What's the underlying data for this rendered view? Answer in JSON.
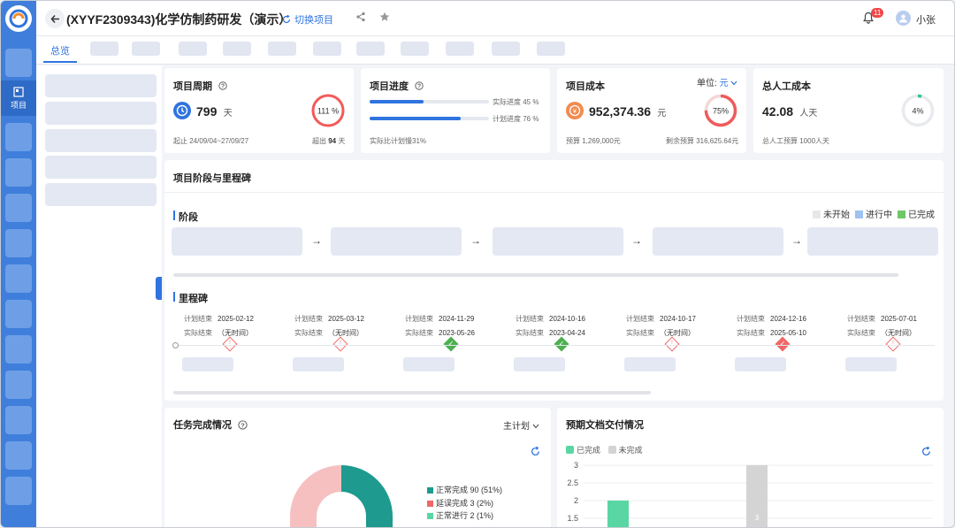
{
  "header": {
    "title": "(XYYF2309343)化学仿制药研发（演示）",
    "switch_label": "切换项目",
    "notification_count": "11",
    "user_name": "小张"
  },
  "rail": {
    "active_label": "项目"
  },
  "tabs": {
    "active": "总览"
  },
  "period": {
    "title": "项目周期",
    "days": "799",
    "unit": "天",
    "percent": "111 %",
    "range": "起止 24/09/04~27/09/27",
    "over_label": "超出",
    "over_days": "94",
    "over_unit": "天"
  },
  "progress": {
    "title": "项目进度",
    "actual_label": "实际进度 45 %",
    "actual_value": 45,
    "planned_label": "计划进度 76 %",
    "planned_value": 76,
    "note": "实际比计划慢31%"
  },
  "cost": {
    "title": "项目成本",
    "unit_label": "单位:",
    "unit_value": "元",
    "amount": "952,374.36",
    "amount_unit": "元",
    "percent": "75%",
    "percent_value": 75,
    "budget": "预算 1,269,000元",
    "remaining": "剩余预算 316,625.64元"
  },
  "labor": {
    "title": "总人工成本",
    "value": "42.08",
    "unit": "人天",
    "percent": "4%",
    "percent_value": 4,
    "budget": "总人工预算 1000人天"
  },
  "milestones_section": {
    "title": "项目阶段与里程碑",
    "stage_label": "阶段",
    "milestone_label": "里程碑",
    "legend": [
      {
        "label": "未开始",
        "color": "#e8e8e8"
      },
      {
        "label": "进行中",
        "color": "#9cc3f2"
      },
      {
        "label": "已完成",
        "color": "#6fc76a"
      }
    ],
    "items": [
      {
        "planned_label": "计划结束",
        "planned": "2025-02-12",
        "actual_label": "实际结束",
        "actual": "（无时间）",
        "status": "late"
      },
      {
        "planned_label": "计划结束",
        "planned": "2025-03-12",
        "actual_label": "实际结束",
        "actual": "（无时间）",
        "status": "late"
      },
      {
        "planned_label": "计划结束",
        "planned": "2024-11-29",
        "actual_label": "实际结束",
        "actual": "2023-05-26",
        "status": "done"
      },
      {
        "planned_label": "计划结束",
        "planned": "2024-10-16",
        "actual_label": "实际结束",
        "actual": "2023-04-24",
        "status": "done"
      },
      {
        "planned_label": "计划结束",
        "planned": "2024-10-17",
        "actual_label": "实际结束",
        "actual": "（无时间）",
        "status": "late"
      },
      {
        "planned_label": "计划结束",
        "planned": "2024-12-16",
        "actual_label": "实际结束",
        "actual": "2025-05-10",
        "status": "done-late"
      },
      {
        "planned_label": "计划结束",
        "planned": "2025-07-01",
        "actual_label": "实际结束",
        "actual": "（无时间）",
        "status": "late"
      }
    ]
  },
  "tasks": {
    "title": "任务完成情况",
    "filter": "主计划",
    "legend": [
      {
        "label": "正常完成 90 (51%)",
        "color": "#1e9a8f"
      },
      {
        "label": "延误完成 3 (2%)",
        "color": "#f06767"
      },
      {
        "label": "正常进行 2 (1%)",
        "color": "#59d6a3"
      }
    ]
  },
  "docs": {
    "title": "预期文档交付情况",
    "legend_done": "已完成",
    "legend_undone": "未完成",
    "bar_label": "3"
  },
  "chart_data": {
    "type": "bar",
    "title": "",
    "xlabel": "",
    "ylabel": "",
    "y_ticks": [
      "3",
      "2.5",
      "2",
      "1.5"
    ],
    "ylim": [
      1.5,
      3
    ],
    "series": [
      {
        "name": "已完成",
        "values": [
          2
        ]
      },
      {
        "name": "未完成",
        "values": [
          3
        ]
      }
    ],
    "colors": {
      "已完成": "#59d6a3",
      "未完成": "#d4d4d4"
    },
    "grid": true,
    "legend_position": "top-left"
  }
}
